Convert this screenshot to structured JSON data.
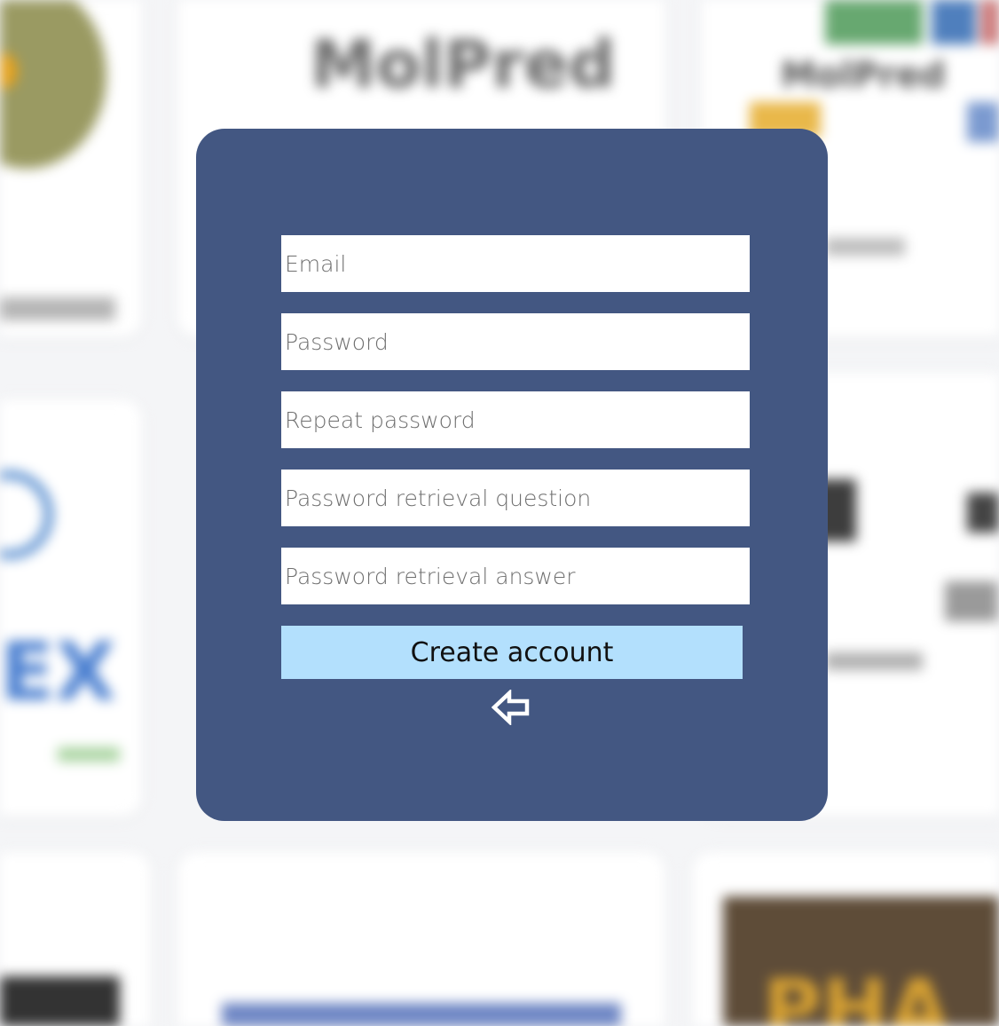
{
  "background": {
    "blurred_logo_text_1": "MolPred",
    "blurred_logo_text_2": "MolPred",
    "blurred_logo_text_3": "PHA"
  },
  "signup_form": {
    "email_placeholder": "Email",
    "password_placeholder": "Password",
    "repeat_password_placeholder": "Repeat password",
    "retrieval_question_placeholder": "Password retrieval question",
    "retrieval_answer_placeholder": "Password retrieval answer",
    "create_account_label": "Create account",
    "back_icon": "back-arrow-icon"
  },
  "colors": {
    "modal_background": "#435782",
    "button_background": "#b3e0fd",
    "field_background": "#ffffff"
  }
}
